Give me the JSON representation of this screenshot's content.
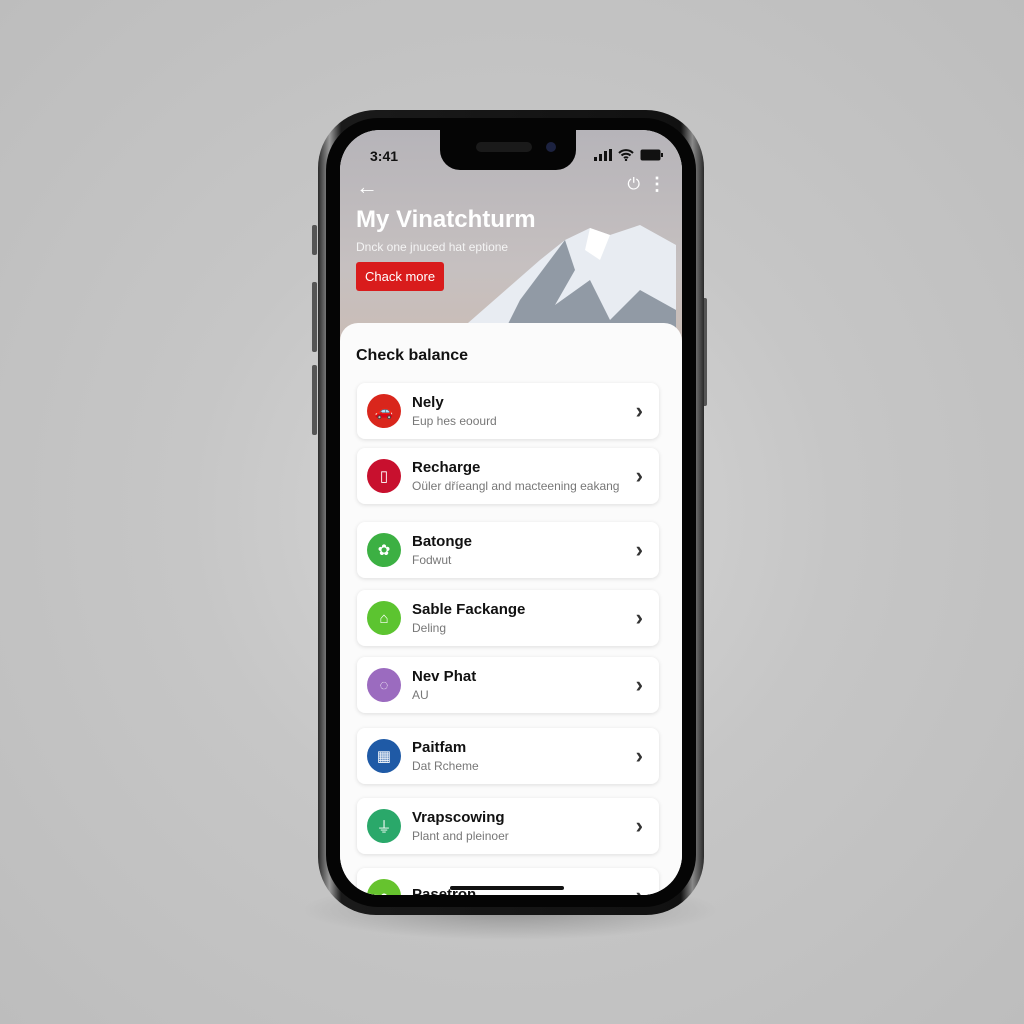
{
  "status_bar": {
    "time": "3:41",
    "icons": [
      "signal-icon",
      "wifi-icon",
      "battery-icon"
    ]
  },
  "header": {
    "title": "My Vinatchturm",
    "subtitle": "Dnck one jnuced hat eptione",
    "cta_label": "Chack more",
    "icons": [
      "back-arrow-icon",
      "power-icon",
      "more-vertical-icon"
    ]
  },
  "sheet": {
    "title": "Check balance",
    "items": [
      {
        "title": "Nely",
        "subtitle": "Eup hes eoourd",
        "color": "#d9261c",
        "icon": "🚗"
      },
      {
        "title": "Recharge",
        "subtitle": "Oüler dříeangl and macteening eakang",
        "color": "#c8102e",
        "icon": "▯"
      },
      {
        "title": "Batonge",
        "subtitle": "Fodwut",
        "color": "#3cb043",
        "icon": "✿"
      },
      {
        "title": "Sable Fackange",
        "subtitle": "Deling",
        "color": "#5cc430",
        "icon": "⌂"
      },
      {
        "title": "Nev Phat",
        "subtitle": "AU",
        "color": "#9b6bbf",
        "icon": "◌"
      },
      {
        "title": "Paitfam",
        "subtitle": "Dat Rcheme",
        "color": "#1f5aa6",
        "icon": "▦"
      },
      {
        "title": "Vrapscowing",
        "subtitle": "Plant and pleinoer",
        "color": "#2aa86a",
        "icon": "⏚"
      },
      {
        "title": "Pasetron",
        "subtitle": "",
        "color": "#66c32e",
        "icon": "●"
      }
    ]
  },
  "colors": {
    "accent": "#d91c1c"
  }
}
